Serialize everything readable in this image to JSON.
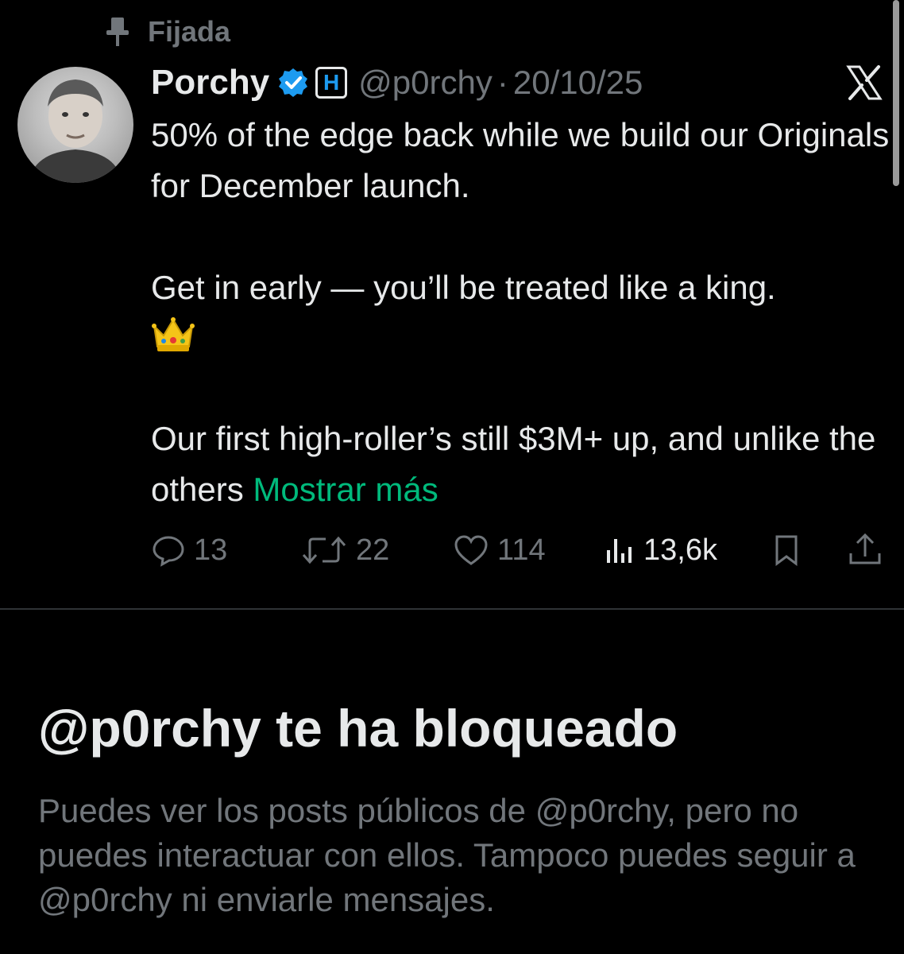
{
  "pinned": {
    "label": "Fijada"
  },
  "tweet": {
    "author_name": "Porchy",
    "affiliate_badge": "H",
    "handle": "@p0rchy",
    "separator": "·",
    "date": "20/10/25",
    "body": {
      "line1": "50% of the edge back while we build our Originals for December launch.",
      "line2": "Get in early — you’ll be treated like a king.",
      "emoji": "crown",
      "line3": "Our first high-roller’s still $3M+ up, and unlike the others ",
      "show_more": "Mostrar más"
    },
    "metrics": {
      "replies": "13",
      "reposts": "22",
      "likes": "114",
      "views": "13,6k"
    }
  },
  "blocked": {
    "title": "@p0rchy te ha bloqueado",
    "description": "Puedes ver los posts públicos de @p0rchy, pero no puedes interactuar con ellos. Tampoco puedes seguir a @p0rchy ni enviarle mensajes."
  },
  "colors": {
    "background": "#000000",
    "text_primary": "#e7e9ea",
    "text_secondary": "#71767b",
    "link_green": "#00ba7c",
    "verified_blue": "#1d9bf0"
  },
  "icons": [
    "pin-icon",
    "verified-badge-icon",
    "x-logo-icon",
    "reply-icon",
    "repost-icon",
    "like-icon",
    "views-icon",
    "bookmark-icon",
    "share-icon",
    "crown-emoji"
  ]
}
